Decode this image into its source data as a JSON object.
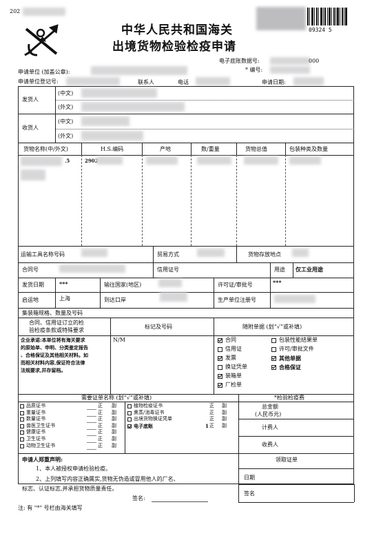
{
  "header": {
    "year_prefix": "202",
    "serial_suffix": "09324 5",
    "title_line1": "中华人民共和国海关",
    "title_line2": "出境货物检验检疫申请",
    "ebook_label": "电子底账数据号:",
    "ebook_value_tail": "000",
    "number_label": "* 编号:"
  },
  "applicant": {
    "unit_label": "申请单位 (加盖公章):",
    "reg_label": "申请单位登记号:",
    "contact_label": "联系人",
    "phone_label": "电话",
    "date_label": "申请日期:"
  },
  "parties": {
    "shipper_label": "发货人",
    "consignee_label": "收货人",
    "cn_label": "(中文)",
    "en_label": "(外文)"
  },
  "goods_table": {
    "headers": [
      "货物名称(中/外文)",
      "H.S.编码",
      "产地",
      "数/重量",
      "货物总值",
      "包装种类及数量"
    ],
    "row1": {
      "name_tail": ".5",
      "hs": "2902"
    }
  },
  "transport": {
    "vehicle_label": "运输工具名称号码",
    "trade_label": "贸易方式",
    "storage_label": "货物存放地点",
    "contract_label": "合同号",
    "lc_label": "信用证号",
    "usage_label": "用途",
    "usage_value": "仅工业用途",
    "ship_date_label": "发货日期",
    "ship_date_value": "***",
    "dest_country_label": "输往国家(地区)",
    "permit_label": "许可证/审批号",
    "permit_value": "***",
    "origin_label": "启运地",
    "origin_value": "上海",
    "port_label": "到达口岸",
    "producer_label": "生产单位注册号"
  },
  "container": {
    "label": "集装箱规格、数量及号码"
  },
  "terms": {
    "header_line1": "合同、信用证订立的检",
    "header_line2": "验检疫条款或特殊要求",
    "marks_header": "标记及号码",
    "docs_header": "随附单据 (划“√”或补填)",
    "marks_value": "N/M",
    "stamp_lines": [
      "企业承诺:本单位将有海关要求",
      "的原始单、申明、分类鉴定报告",
      "、合格保证及其他相关材料。如",
      "而相关材料内容,保证符合法律",
      "法规要求,并存留档。"
    ],
    "docs_left": [
      {
        "label": "合同",
        "checked": true
      },
      {
        "label": "信用证",
        "checked": false
      },
      {
        "label": "发票",
        "checked": true
      },
      {
        "label": "换证凭单",
        "checked": false
      },
      {
        "label": "装箱单",
        "checked": true
      },
      {
        "label": "厂检单",
        "checked": true
      }
    ],
    "docs_right": [
      {
        "label": "包装性能结果单",
        "checked": false
      },
      {
        "label": "许可/审批文件",
        "checked": false
      },
      {
        "label": "其他单据",
        "checked": true
      },
      {
        "label": "合格保证",
        "checked": true
      }
    ]
  },
  "certs": {
    "header": "需要证单名称 (划“√”或补填)",
    "fee_header": "*检验检疫费",
    "total_label": "总金额",
    "total_unit": "(人民币元)",
    "calc_label": "计费人",
    "collect_label": "收费人",
    "zheng": "正",
    "fu": "副",
    "left": [
      "品质证书",
      "重量证书",
      "数量证书",
      "兽医卫生证书",
      "健康证书",
      "卫生证书",
      "动物卫生证书"
    ],
    "mid": [
      "植物检疫证书",
      "熏蒸/消毒证书",
      "出境货物换证凭单",
      "电子底账"
    ],
    "mid_checked_index": 3,
    "ebook_count": "1"
  },
  "declaration": {
    "title": "申请人郑重声明:",
    "line1": "1、本人被授权申请检验检疫。",
    "line2": "2、上列填写内容正确属实,货物无伪造或冒用他人的厂名、",
    "line3": "标志、认证标志,并承担货物质量责任。",
    "sign_label": "签名:",
    "receive_header": "领取证单",
    "date_label": "日期",
    "sign2_label": "签名"
  },
  "footer": {
    "note": "注: 有 \"*\" 号栏由海关填写"
  }
}
